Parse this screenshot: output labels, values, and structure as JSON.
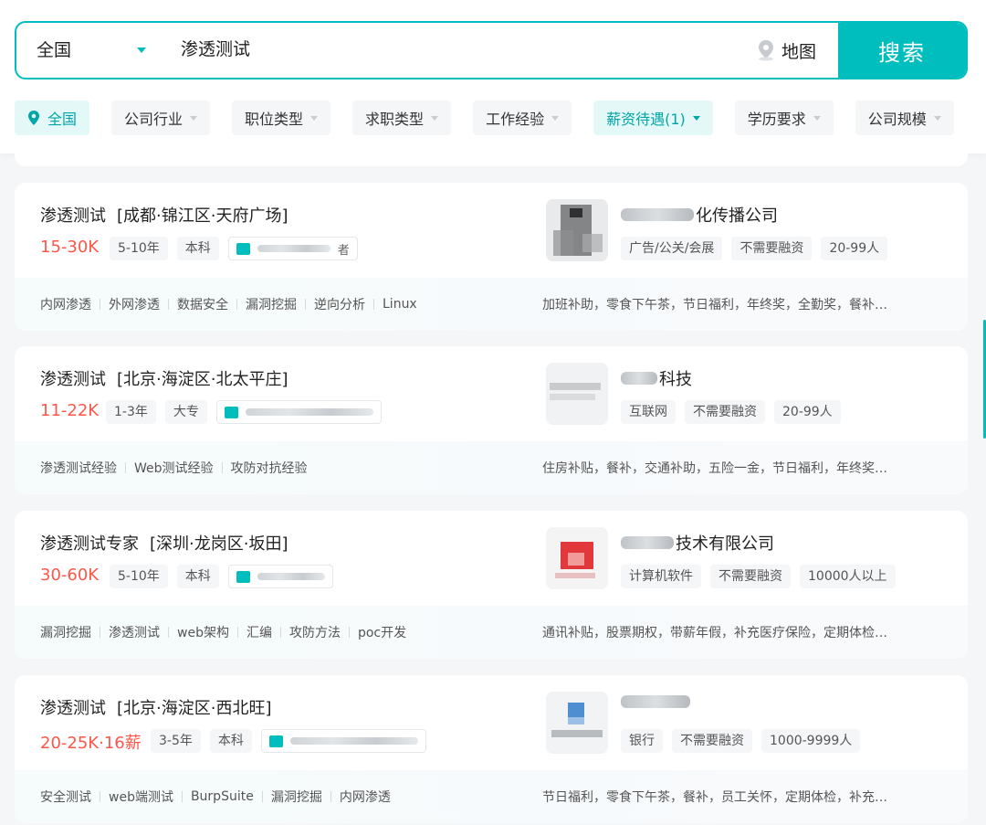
{
  "search": {
    "city": "全国",
    "query": "渗透测试",
    "map_label": "地图",
    "button_label": "搜索"
  },
  "filters": [
    {
      "label": "全国",
      "active": true,
      "icon": "location-pin-icon"
    },
    {
      "label": "公司行业"
    },
    {
      "label": "职位类型"
    },
    {
      "label": "求职类型"
    },
    {
      "label": "工作经验"
    },
    {
      "label": "薪资待遇(1)",
      "active": true
    },
    {
      "label": "学历要求"
    },
    {
      "label": "公司规模"
    }
  ],
  "jobs": [
    {
      "title": "渗透测试",
      "area": "[成都·锦江区·天府广场]",
      "salary": "15-30K",
      "experience": "5-10年",
      "education": "本科",
      "recruiter_visible": "者",
      "company_visible": "化传播公司",
      "company_tags": [
        "广告/公关/会展",
        "不需要融资",
        "20-99人"
      ],
      "skills": [
        "内网渗透",
        "外网渗透",
        "数据安全",
        "漏洞挖掘",
        "逆向分析",
        "Linux"
      ],
      "welfare": "加班补助，零食下午茶，节日福利，年终奖，全勤奖，餐补…"
    },
    {
      "title": "渗透测试",
      "area": "[北京·海淀区·北太平庄]",
      "salary": "11-22K",
      "experience": "1-3年",
      "education": "大专",
      "recruiter_visible": "",
      "company_visible": "科技",
      "company_tags": [
        "互联网",
        "不需要融资",
        "20-99人"
      ],
      "skills": [
        "渗透测试经验",
        "Web测试经验",
        "攻防对抗经验"
      ],
      "welfare": "住房补贴，餐补，交通补助，五险一金，节日福利，年终奖…"
    },
    {
      "title": "渗透测试专家",
      "area": "[深圳·龙岗区·坂田]",
      "salary": "30-60K",
      "experience": "5-10年",
      "education": "本科",
      "recruiter_visible": "",
      "company_visible": "技术有限公司",
      "company_tags": [
        "计算机软件",
        "不需要融资",
        "10000人以上"
      ],
      "skills": [
        "漏洞挖掘",
        "渗透测试",
        "web架构",
        "汇编",
        "攻防方法",
        "poc开发"
      ],
      "welfare": "通讯补贴，股票期权，带薪年假，补充医疗保险，定期体检…"
    },
    {
      "title": "渗透测试",
      "area": "[北京·海淀区·西北旺]",
      "salary": "20-25K·16薪",
      "experience": "3-5年",
      "education": "本科",
      "recruiter_visible": "",
      "company_visible": "",
      "company_tags": [
        "银行",
        "不需要融资",
        "1000-9999人"
      ],
      "skills": [
        "安全测试",
        "web端测试",
        "BurpSuite",
        "漏洞挖掘",
        "内网渗透"
      ],
      "welfare": "节日福利，零食下午茶，餐补，员工关怀，定期体检，补充…"
    }
  ],
  "colors": {
    "accent": "#00bebd",
    "salary": "#fe574a"
  }
}
